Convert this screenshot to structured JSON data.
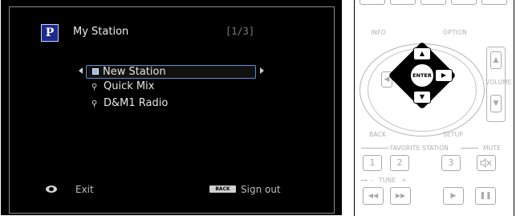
{
  "screen": {
    "logo_letter": "P",
    "title": "My Station",
    "page_indicator": "[1/3]",
    "menu": [
      {
        "label": "New Station",
        "selected": true
      },
      {
        "label": "Quick Mix",
        "selected": false
      },
      {
        "label": "D&M1 Radio",
        "selected": false
      }
    ],
    "footer": {
      "exit_label": "Exit",
      "back_key_text": "BACK",
      "signout_label": "Sign out"
    }
  },
  "remote": {
    "info_label": "INFO",
    "option_label": "OPTION",
    "volume_label": "VOLUME",
    "back_label": "BACK",
    "setup_label": "SETUP",
    "enter_label": "ENTER",
    "favorite_label": "FAVORITE STATION",
    "mute_label": "MUTE",
    "tune_label": "TUNE",
    "tune_minus": "–",
    "tune_plus": "+",
    "favorite_buttons": [
      "1",
      "2",
      "3"
    ],
    "mute_icon": "mute-speaker-icon",
    "transport_icons": [
      "previous-icon",
      "next-icon",
      "play-icon",
      "pause-icon"
    ]
  },
  "colors": {
    "screen_bg": "#000000",
    "selection_border": "#5b8ed6",
    "logo_bg": "#1b2a8c",
    "remote_line": "#a9a9a9"
  }
}
